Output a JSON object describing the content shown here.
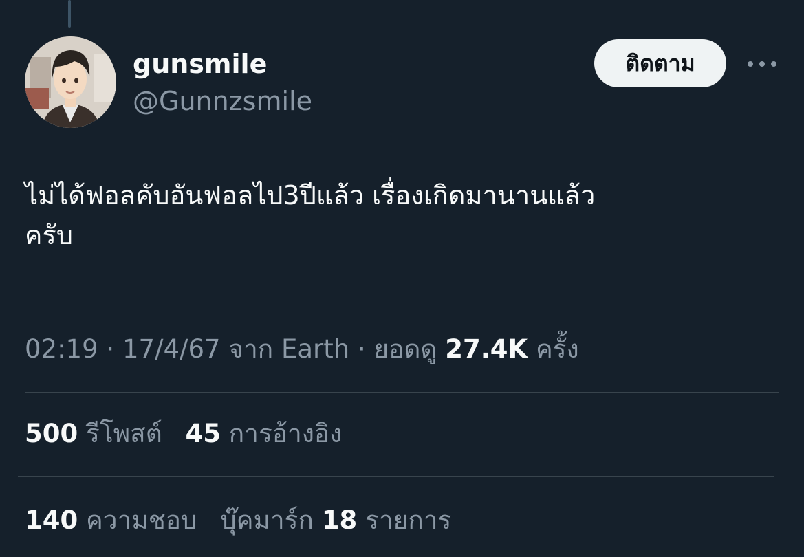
{
  "author": {
    "display_name": "gunsmile",
    "handle": "@Gunnzsmile"
  },
  "follow_label": "ติดตาม",
  "more_icon": "ellipsis-icon",
  "tweet": {
    "line1": "ไม่ได้ฟอลคับอันฟอลไป3ปีแล้ว เรื่องเกิดมานานแล้ว",
    "line2": "ครับ"
  },
  "meta": {
    "time": "02:19",
    "sep1": " · ",
    "date": "17/4/67",
    "source_prefix": " จาก ",
    "source": "Earth",
    "sep2": " · ",
    "views_label": "ยอดดู ",
    "views_count": "27.4K",
    "views_suffix": " ครั้ง"
  },
  "stats": {
    "reposts_count": "500",
    "reposts_label": " รีโพสต์",
    "quotes_count": "45",
    "quotes_label": " การอ้างอิง",
    "likes_count": "140",
    "likes_label": " ความชอบ",
    "bookmarks_label": "บุ๊คมาร์ก ",
    "bookmarks_count": "18",
    "bookmarks_suffix": " รายการ"
  },
  "colors": {
    "background": "#15202b",
    "primary_text": "#f7f9f9",
    "secondary_text": "#8b98a5",
    "divider": "#38444d",
    "follow_button_bg": "#eff3f4"
  }
}
